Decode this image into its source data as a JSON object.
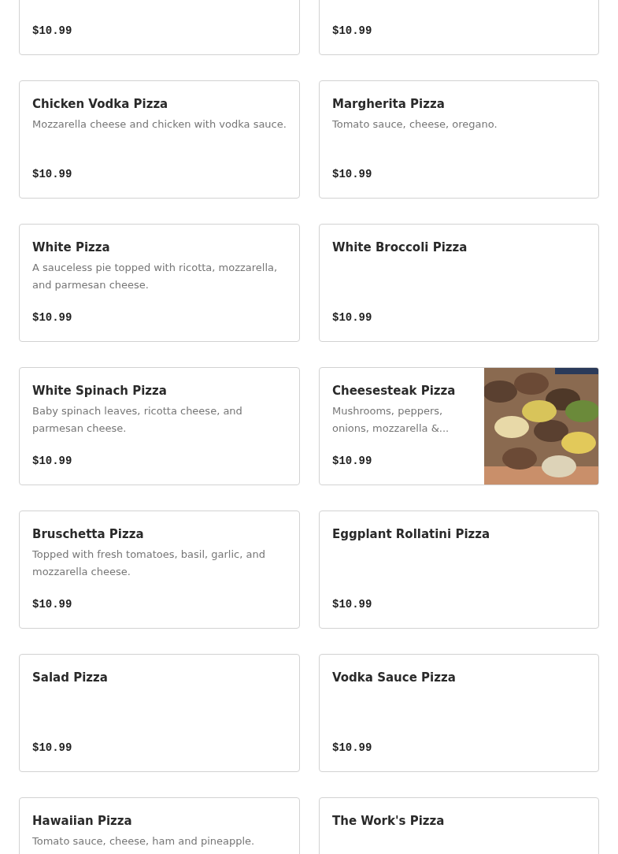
{
  "menu_items": [
    {
      "kind": "clipped",
      "price": "$10.99"
    },
    {
      "kind": "clipped",
      "price": "$10.99"
    },
    {
      "kind": "text",
      "name": "Chicken Vodka Pizza",
      "description": "Mozzarella cheese and chicken with vodka sauce.",
      "price": "$10.99"
    },
    {
      "kind": "text",
      "name": "Margherita Pizza",
      "description": "Tomato sauce, cheese, oregano.",
      "price": "$10.99"
    },
    {
      "kind": "text",
      "name": "White Pizza",
      "description": "A sauceless pie topped with ricotta, mozzarella, and parmesan cheese.",
      "price": "$10.99"
    },
    {
      "kind": "text",
      "name": "White Broccoli Pizza",
      "price": "$10.99"
    },
    {
      "kind": "text",
      "name": "White Spinach Pizza",
      "description": "Baby spinach leaves, ricotta cheese, and parmesan cheese.",
      "price": "$10.99"
    },
    {
      "kind": "picture",
      "name": "Cheesesteak Pizza",
      "description": "Mushrooms, peppers, onions, mozzarella &...",
      "price": "$10.99"
    },
    {
      "kind": "text",
      "name": "Bruschetta Pizza",
      "description": "Topped with fresh tomatoes, basil, garlic, and mozzarella cheese.",
      "price": "$10.99"
    },
    {
      "kind": "text",
      "name": "Eggplant Rollatini Pizza",
      "price": "$10.99"
    },
    {
      "kind": "text",
      "name": "Salad Pizza",
      "price": "$10.99"
    },
    {
      "kind": "text",
      "name": "Vodka Sauce Pizza",
      "price": "$10.99"
    },
    {
      "kind": "text",
      "name": "Hawaiian Pizza",
      "description": "Tomato sauce, cheese, ham and pineapple."
    },
    {
      "kind": "text",
      "name": "The Work's Pizza"
    }
  ]
}
